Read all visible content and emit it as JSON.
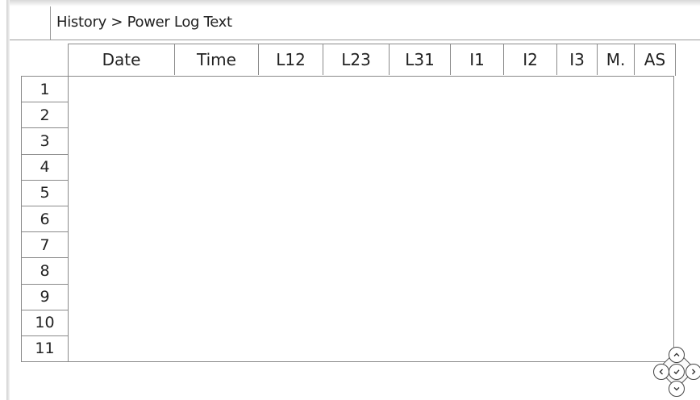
{
  "header": {
    "breadcrumb": "History > Power Log Text"
  },
  "table": {
    "columns": [
      "Date",
      "Time",
      "L12",
      "L23",
      "L31",
      "I1",
      "I2",
      "I3",
      "M.",
      "AS"
    ],
    "rows": [
      "1",
      "2",
      "3",
      "4",
      "5",
      "6",
      "7",
      "8",
      "9",
      "10",
      "11"
    ]
  },
  "navpad": {
    "up_icon": "chevron-up-icon",
    "down_icon": "chevron-down-icon",
    "left_icon": "chevron-left-icon",
    "right_icon": "chevron-right-icon",
    "ok_icon": "check-icon"
  }
}
